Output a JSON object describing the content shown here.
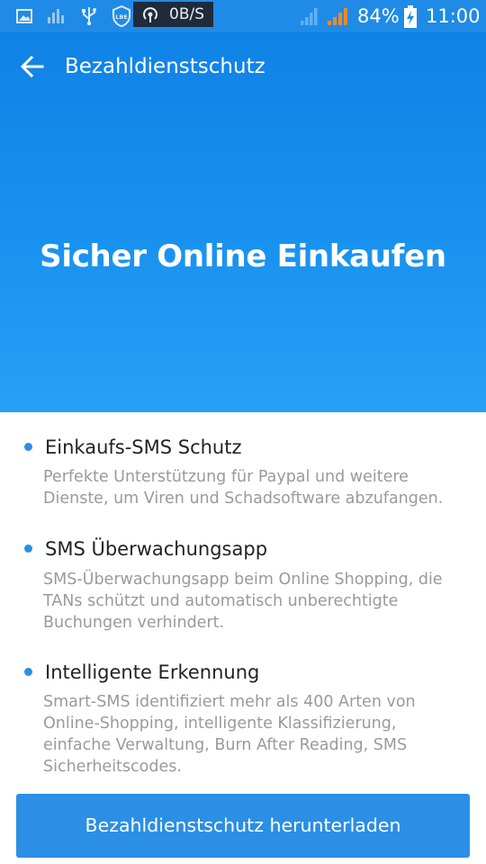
{
  "status_bar": {
    "net_speed": "0B/S",
    "battery": "84%",
    "time": "11:00",
    "icons": [
      "gallery-icon",
      "equalizer-icon",
      "usb-icon",
      "lbe-icon",
      "hotspot-icon",
      "signal-icon",
      "signal-icon",
      "battery-charging-icon"
    ]
  },
  "appbar": {
    "title": "Bezahldienstschutz"
  },
  "hero": {
    "headline": "Sicher Online Einkaufen"
  },
  "features": [
    {
      "title": "Einkaufs-SMS Schutz",
      "lines": [
        "Perfekte Unterstützung für Paypal und weitere",
        "Dienste, um Viren und Schadsoftware abzufangen."
      ]
    },
    {
      "title": "SMS Überwachungsapp",
      "lines": [
        "SMS-Überwachungsapp beim Online Shopping, die",
        "TANs schützt und automatisch unberechtigte",
        "Buchungen verhindert."
      ]
    },
    {
      "title": "Intelligente Erkennung",
      "lines": [
        "Smart-SMS identifiziert mehr als 400 Arten von",
        "Online-Shopping, intelligente Klassifizierung,",
        "einfache Verwaltung, Burn After Reading, SMS",
        "Sicherheitscodes."
      ]
    }
  ],
  "cta": {
    "label": "Bezahldienstschutz herunterladen"
  },
  "colors": {
    "primary": "#1f8be6",
    "button": "#2a8fe5",
    "desc_text": "#9a9a9a"
  }
}
